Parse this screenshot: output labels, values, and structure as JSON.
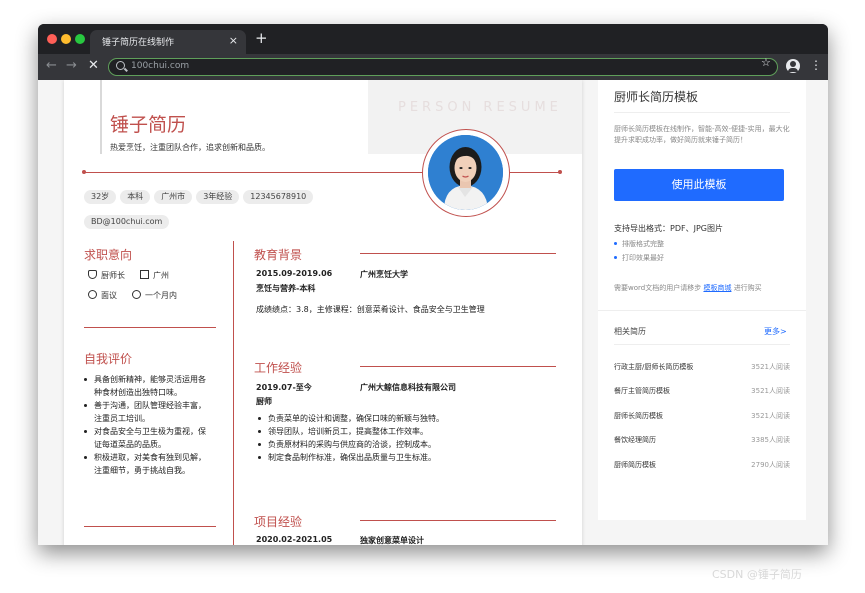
{
  "browser": {
    "tab_title": "锤子简历在线制作",
    "tab_close": "×",
    "new_tab": "+",
    "url": "100chui.com",
    "icons": [
      "back-arrow-icon",
      "forward-arrow-icon",
      "stop-loading-icon",
      "search-icon",
      "star-icon",
      "account-icon",
      "more-menu-icon"
    ],
    "colors": {
      "frame": "#202124",
      "toolbar": "#35363a",
      "omnibox_border": "#5f9f5a"
    }
  },
  "resume": {
    "watermark": "PERSON RESUME",
    "name": "锤子简历",
    "tagline": "热爱烹饪，注重团队合作，追求创新和品质。",
    "tags": [
      "32岁",
      "本科",
      "广州市",
      "3年经验",
      "12345678910",
      "BD@100chui.com"
    ],
    "accent_color": "#c0504d",
    "intent": {
      "title": "求职意向",
      "position": "厨师长",
      "city": "广州",
      "salary": "面议",
      "availability": "一个月内"
    },
    "self_eval": {
      "title": "自我评价",
      "items": [
        "具备创新精神，能够灵活运用各种食材创造出独特口味。",
        "善于沟通，团队管理经验丰富，注重员工培训。",
        "对食品安全与卫生极为重视，保证每道菜品的品质。",
        "积极进取，对美食有独到见解，注重细节，勇于挑战自我。"
      ]
    },
    "education": {
      "title": "教育背景",
      "period": "2015.09-2019.06",
      "school": "广州烹饪大学",
      "major": "烹饪与营养-本科",
      "detail": "成绩绩点：3.8，主修课程：创意菜肴设计、食品安全与卫生管理"
    },
    "work": {
      "title": "工作经验",
      "period": "2019.07-至今",
      "company": "广州大鲸信息科技有限公司",
      "role": "厨师",
      "items": [
        "负责菜单的设计和调整，确保口味的新颖与独特。",
        "领导团队，培训新员工，提高整体工作效率。",
        "负责原材料的采购与供应商的洽谈，控制成本。",
        "制定食品制作标准，确保出品质量与卫生标准。"
      ]
    },
    "project": {
      "title": "项目经验",
      "period": "2020.02-2021.05",
      "name": "独家创意菜单设计"
    }
  },
  "sidebar": {
    "title": "厨师长简历模板",
    "description": "厨师长简历模板在线制作，智能-高效-便捷-实用，最大化提升求职成功率，做好简历就来锤子简历！",
    "use_button": "使用此模板",
    "formats": "支持导出格式：PDF、JPG图片",
    "features": [
      "排版格式完整",
      "打印效果最好"
    ],
    "word_prefix": "需要word文档的用户请移步",
    "word_link": "模板商城",
    "word_suffix": "进行购买",
    "related_title": "相关简历",
    "more": "更多>",
    "related": [
      {
        "name": "行政主厨/厨师长简历模板",
        "count": "3521人阅读"
      },
      {
        "name": "餐厅主管简历模板",
        "count": "3521人阅读"
      },
      {
        "name": "厨师长简历模板",
        "count": "3521人阅读"
      },
      {
        "name": "餐饮经理简历",
        "count": "3385人阅读"
      },
      {
        "name": "厨师简历模板",
        "count": "2790人阅读"
      }
    ],
    "button_color": "#1f6bff"
  },
  "watermark_corner": "CSDN @锤子简历"
}
